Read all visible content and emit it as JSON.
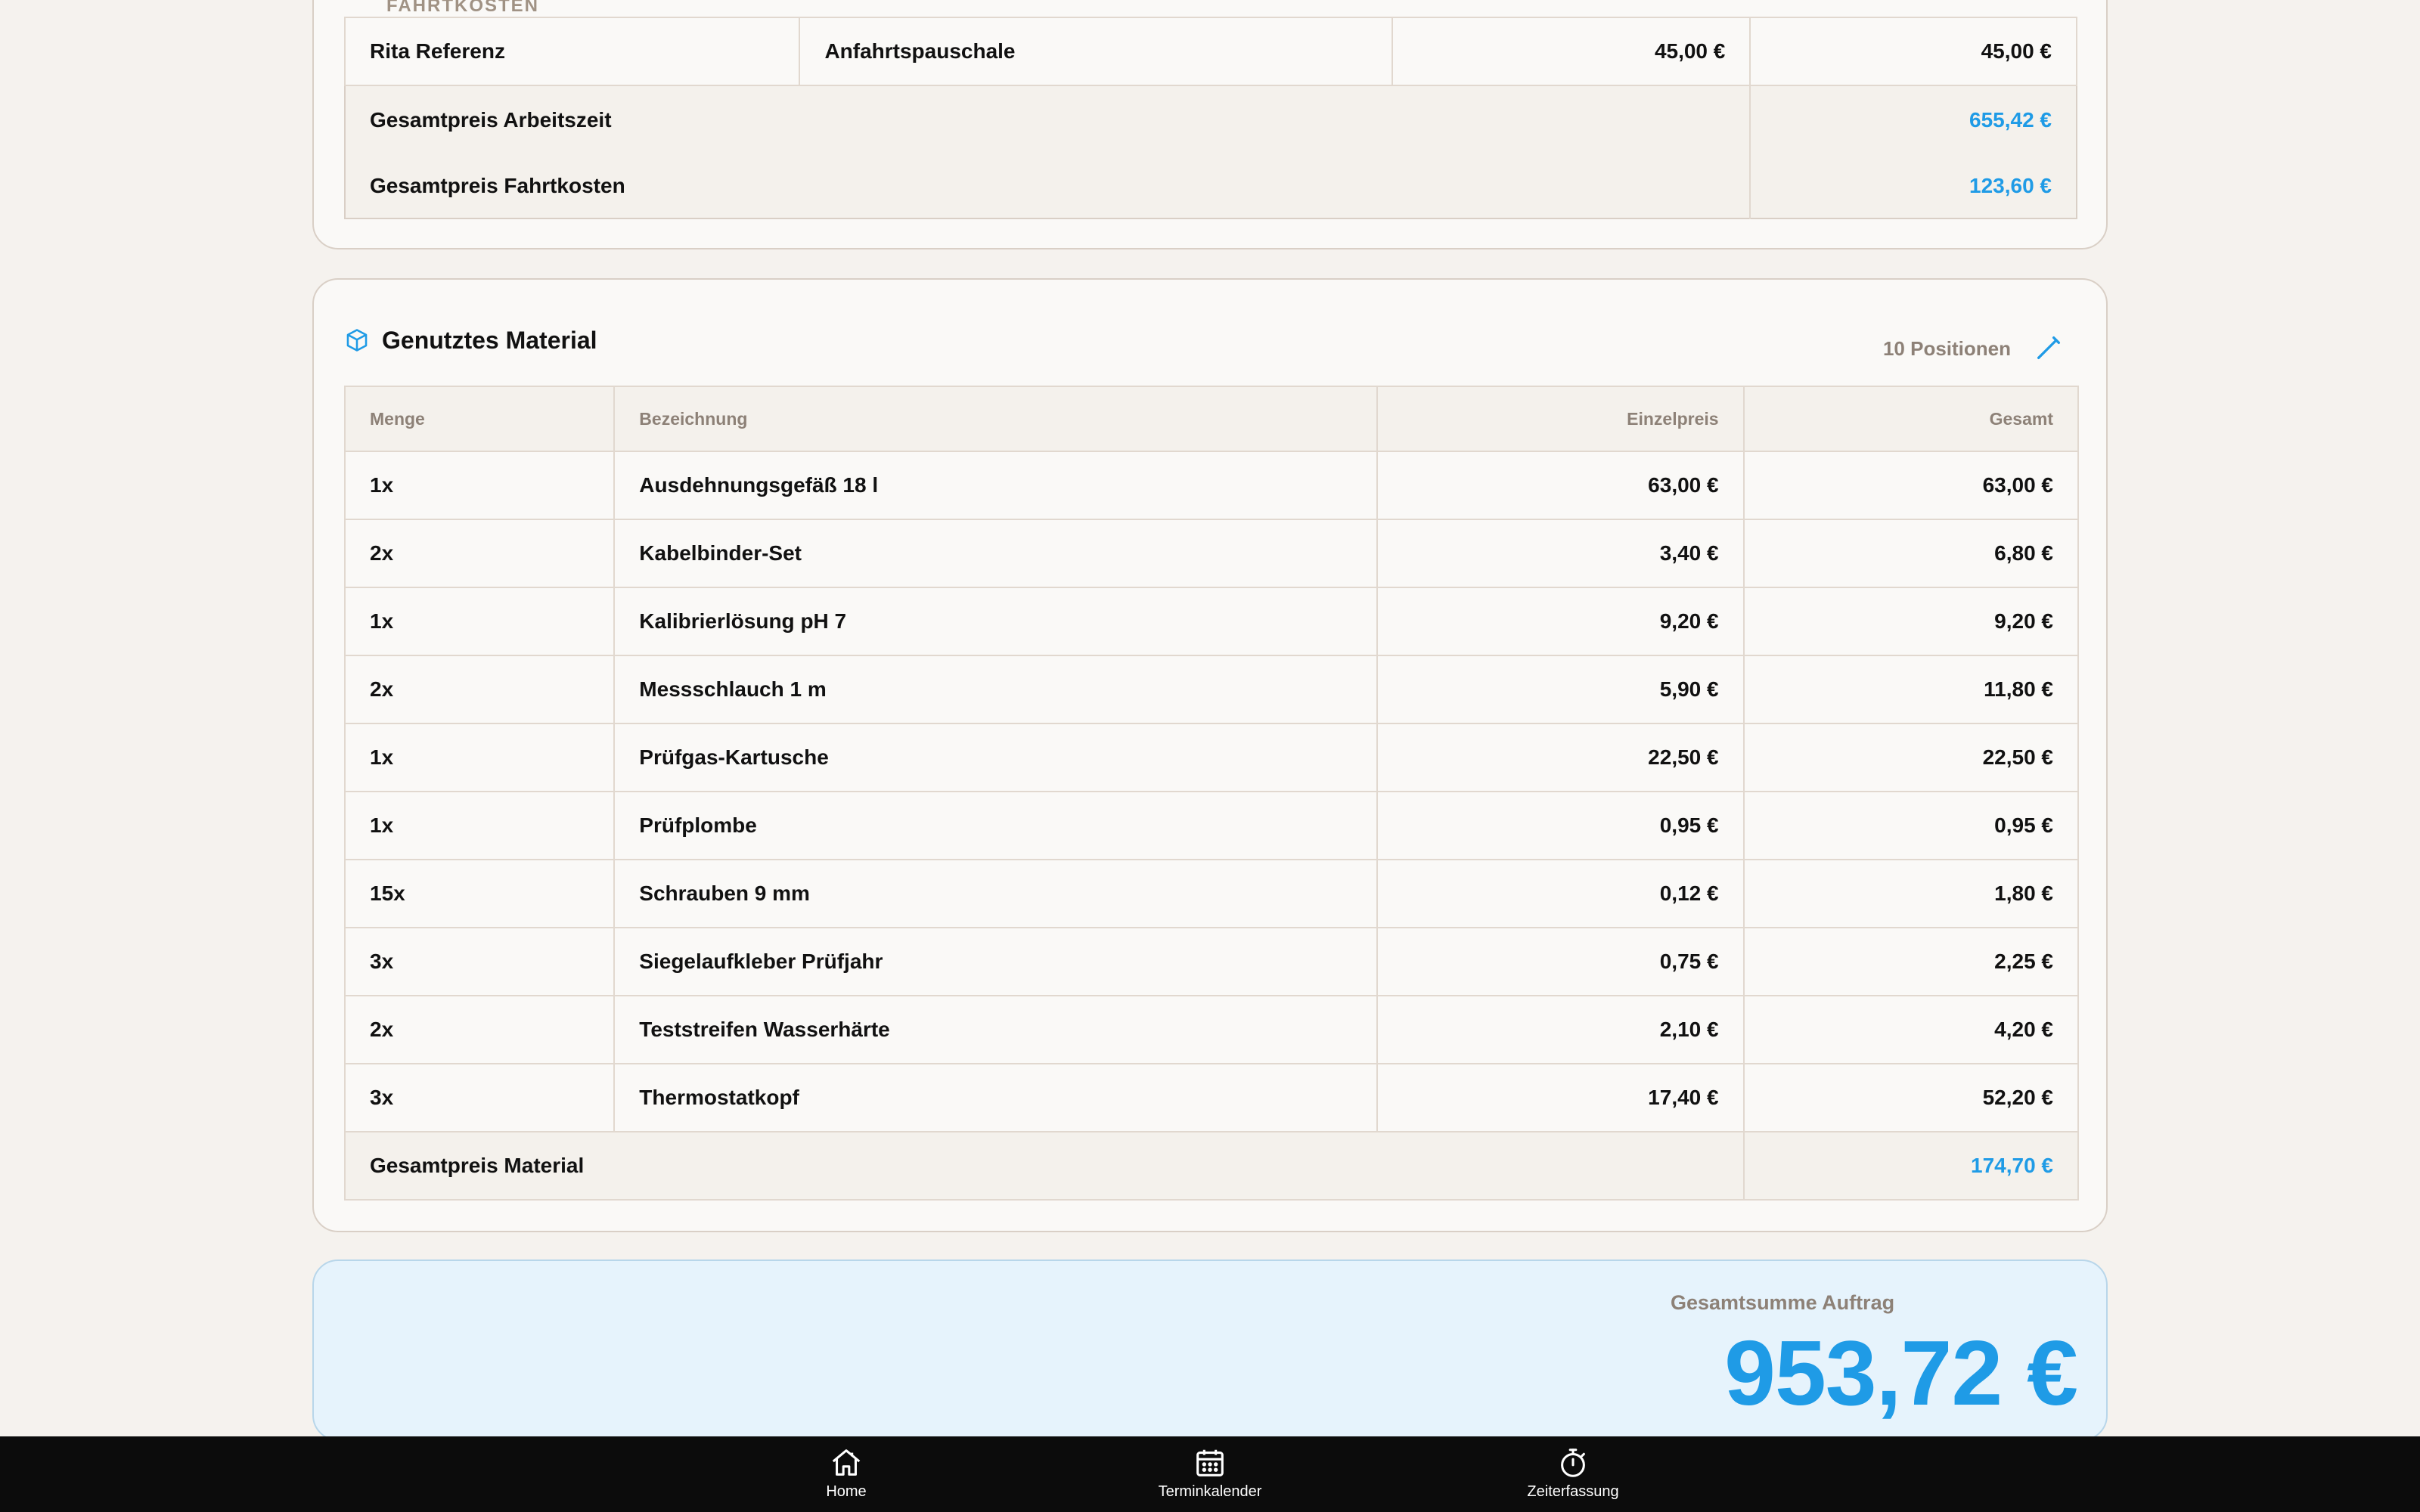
{
  "travel": {
    "section_label": "Fahrtkosten",
    "rows": [
      {
        "name": "Rita Referenz",
        "item": "Anfahrtspauschale",
        "unit_price": "45,00 €",
        "total": "45,00 €"
      }
    ],
    "sum_work_label": "Gesamtpreis Arbeitszeit",
    "sum_work_value": "655,42 €",
    "sum_travel_label": "Gesamtpreis Fahrtkosten",
    "sum_travel_value": "123,60 €"
  },
  "material": {
    "title": "Genutztes Material",
    "count": "10 Positionen",
    "headers": {
      "qty": "Menge",
      "name": "Bezeichnung",
      "unit": "Einzelpreis",
      "total": "Gesamt"
    },
    "rows": [
      {
        "qty": "1x",
        "name": "Ausdehnungsgefäß 18 l",
        "unit": "63,00 €",
        "total": "63,00 €"
      },
      {
        "qty": "2x",
        "name": "Kabelbinder-Set",
        "unit": "3,40 €",
        "total": "6,80 €"
      },
      {
        "qty": "1x",
        "name": "Kalibrierlösung pH 7",
        "unit": "9,20 €",
        "total": "9,20 €"
      },
      {
        "qty": "2x",
        "name": "Messschlauch 1 m",
        "unit": "5,90 €",
        "total": "11,80 €"
      },
      {
        "qty": "1x",
        "name": "Prüfgas-Kartusche",
        "unit": "22,50 €",
        "total": "22,50 €"
      },
      {
        "qty": "1x",
        "name": "Prüfplombe",
        "unit": "0,95 €",
        "total": "0,95 €"
      },
      {
        "qty": "15x",
        "name": "Schrauben 9 mm",
        "unit": "0,12 €",
        "total": "1,80 €"
      },
      {
        "qty": "3x",
        "name": "Siegelaufkleber Prüfjahr",
        "unit": "0,75 €",
        "total": "2,25 €"
      },
      {
        "qty": "2x",
        "name": "Teststreifen Wasserhärte",
        "unit": "2,10 €",
        "total": "4,20 €"
      },
      {
        "qty": "3x",
        "name": "Thermostatkopf",
        "unit": "17,40 €",
        "total": "52,20 €"
      }
    ],
    "sum_label": "Gesamtpreis Material",
    "sum_value": "174,70 €"
  },
  "total": {
    "label": "Gesamtsumme Auftrag",
    "value": "953,72 €"
  },
  "nav": {
    "home": "Home",
    "calendar": "Terminkalender",
    "time": "Zeiterfassung"
  },
  "colors": {
    "accent": "#1f9be6",
    "background": "#f5f2ee",
    "nav_bg": "#0c0c0c"
  },
  "icons": [
    "cube-icon",
    "edit-pencil-icon",
    "home-icon",
    "calendar-icon",
    "stopwatch-icon"
  ]
}
